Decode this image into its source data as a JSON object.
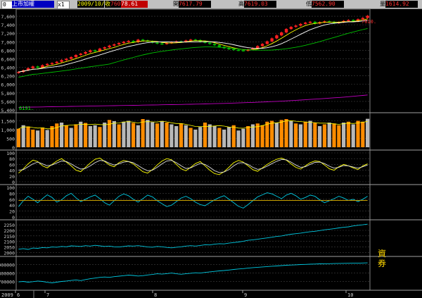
{
  "toolbar": {
    "symbol_code": "0",
    "symbol_name": "上市加權",
    "period": "x1",
    "date": "2009/10/07",
    "close_label": "收",
    "close": "7608.66",
    "open_label": "開",
    "open": "7617.79",
    "high_label": "高",
    "high": "7619.03",
    "low_label": "低",
    "low": "7562.90",
    "volume_label": "量",
    "volume": "1614.92",
    "change": "78.61"
  },
  "annotations": {
    "last_price": "7610.",
    "price_low_marker": "6191.",
    "side_label": "資券"
  },
  "colors": {
    "up": "#ff2020",
    "down": "#00c000",
    "vol_orange": "#ff8c00",
    "vol_gray": "#b8b8b8",
    "ma5": "#ffff00",
    "ma10": "#ffffff",
    "ma20": "#00c000",
    "ma60": "#c000c0",
    "cyan": "#00c8e0",
    "grid": "#404040"
  },
  "chart_data": [
    {
      "type": "candlestick",
      "name": "price",
      "y_ticks": [
        "7,600",
        "7,400",
        "7,200",
        "7,000",
        "6,800",
        "6,600",
        "6,400",
        "6,200",
        "6,000",
        "5,800",
        "5,600",
        "5,400"
      ],
      "ylim": [
        5400,
        7700
      ],
      "close": [
        6290,
        6330,
        6380,
        6420,
        6390,
        6450,
        6480,
        6500,
        6530,
        6570,
        6600,
        6640,
        6690,
        6720,
        6760,
        6800,
        6780,
        6840,
        6870,
        6910,
        6940,
        6970,
        7000,
        7020,
        6990,
        7050,
        7030,
        7010,
        6980,
        6960,
        6950,
        6970,
        6990,
        7010,
        7000,
        7030,
        7050,
        7040,
        7000,
        6980,
        6950,
        6920,
        6880,
        6850,
        6830,
        6810,
        6800,
        6790,
        6820,
        6850,
        6900,
        6950,
        7010,
        7080,
        7150,
        7220,
        7300,
        7350,
        7380,
        7420,
        7450,
        7470,
        7430,
        7460,
        7480,
        7470,
        7440,
        7460,
        7490,
        7510,
        7480,
        7530,
        7560,
        7610
      ],
      "ma60": [
        5460,
        5462,
        5464,
        5466,
        5468,
        5470,
        5472,
        5474,
        5476,
        5478,
        5480,
        5482,
        5484,
        5486,
        5488,
        5490,
        5492,
        5494,
        5496,
        5498,
        5500,
        5502,
        5504,
        5506,
        5508,
        5510,
        5512,
        5514,
        5516,
        5518,
        5520,
        5522,
        5524,
        5526,
        5528,
        5530,
        5532,
        5535,
        5538,
        5541,
        5544,
        5547,
        5550,
        5553,
        5556,
        5560,
        5564,
        5568,
        5572,
        5576,
        5580,
        5585,
        5590,
        5595,
        5600,
        5606,
        5612,
        5618,
        5625,
        5632,
        5639,
        5646,
        5653,
        5660,
        5668,
        5676,
        5684,
        5692,
        5700,
        5710,
        5720,
        5730,
        5740,
        5750
      ]
    },
    {
      "type": "bar",
      "name": "volume",
      "y_ticks": [
        "1,500",
        "1,000",
        "500",
        "0"
      ],
      "ylim": [
        0,
        1800
      ],
      "values": [
        1050,
        1250,
        1180,
        1000,
        950,
        1120,
        980,
        1200,
        1350,
        1400,
        1250,
        1100,
        1300,
        1450,
        1380,
        1200,
        1250,
        1150,
        1400,
        1550,
        1480,
        1300,
        1450,
        1500,
        1380,
        1250,
        1600,
        1550,
        1420,
        1350,
        1480,
        1400,
        1300,
        1200,
        1350,
        1250,
        1100,
        1000,
        1150,
        1400,
        1300,
        1200,
        1100,
        1000,
        1150,
        1250,
        950,
        1050,
        1200,
        1300,
        1350,
        1250,
        1450,
        1500,
        1400,
        1550,
        1600,
        1480,
        1350,
        1300,
        1450,
        1500,
        1380,
        1200,
        1300,
        1400,
        1350,
        1250,
        1400,
        1450,
        1300,
        1500,
        1450,
        1614
      ],
      "up": [
        1,
        0,
        1,
        1,
        0,
        1,
        0,
        1,
        1,
        0,
        1,
        0,
        1,
        0,
        1,
        0,
        0,
        1,
        0,
        1,
        0,
        1,
        0,
        0,
        1,
        0,
        1,
        0,
        0,
        1,
        0,
        1,
        0,
        0,
        1,
        0,
        1,
        0,
        0,
        1,
        0,
        0,
        1,
        0,
        0,
        1,
        0,
        0,
        1,
        0,
        1,
        1,
        1,
        1,
        0,
        1,
        1,
        0,
        1,
        0,
        1,
        0,
        1,
        0,
        1,
        0,
        1,
        1,
        0,
        1,
        0,
        1,
        1,
        0
      ]
    },
    {
      "type": "line",
      "name": "KD",
      "y_ticks": [
        "100",
        "80",
        "60",
        "40",
        "20",
        "0"
      ],
      "ylim": [
        0,
        100
      ],
      "series": [
        {
          "color": "#ffff00",
          "values": [
            30,
            45,
            62,
            75,
            70,
            55,
            48,
            60,
            72,
            80,
            68,
            55,
            40,
            35,
            50,
            65,
            78,
            82,
            70,
            58,
            52,
            66,
            74,
            70,
            62,
            48,
            35,
            30,
            42,
            58,
            72,
            80,
            76,
            60,
            45,
            38,
            50,
            63,
            70,
            55,
            40,
            28,
            25,
            35,
            50,
            66,
            74,
            68,
            55,
            42,
            36,
            48,
            60,
            70,
            78,
            82,
            75,
            62,
            50,
            44,
            55,
            66,
            72,
            70,
            58,
            45,
            40,
            52,
            60,
            55,
            48,
            42,
            55,
            62
          ]
        },
        {
          "color": "#e0e0e0",
          "values": [
            40,
            42,
            52,
            62,
            68,
            62,
            55,
            58,
            65,
            72,
            70,
            62,
            52,
            44,
            46,
            55,
            66,
            74,
            72,
            64,
            58,
            62,
            68,
            70,
            66,
            56,
            46,
            38,
            40,
            50,
            62,
            72,
            74,
            66,
            55,
            46,
            48,
            56,
            64,
            60,
            50,
            38,
            32,
            34,
            42,
            55,
            65,
            66,
            60,
            50,
            43,
            46,
            54,
            63,
            71,
            77,
            76,
            68,
            58,
            50,
            52,
            60,
            67,
            68,
            63,
            54,
            47,
            50,
            56,
            55,
            51,
            47,
            52,
            58
          ]
        }
      ]
    },
    {
      "type": "line",
      "name": "RSI",
      "y_ticks": [
        "100",
        "80",
        "60",
        "40",
        "20",
        "0"
      ],
      "ylim": [
        0,
        100
      ],
      "series": [
        {
          "color": "#00c8e0",
          "values": [
            35,
            55,
            70,
            60,
            48,
            62,
            75,
            66,
            50,
            58,
            72,
            80,
            65,
            52,
            60,
            68,
            74,
            62,
            48,
            40,
            55,
            70,
            78,
            72,
            60,
            50,
            62,
            74,
            68,
            55,
            45,
            35,
            40,
            52,
            64,
            70,
            62,
            50,
            42,
            38,
            48,
            58,
            66,
            72,
            60,
            48,
            36,
            30,
            42,
            55,
            68,
            75,
            82,
            78,
            70,
            62,
            74,
            80,
            72,
            60,
            66,
            74,
            70,
            58,
            48,
            55,
            62,
            70,
            64,
            56,
            60,
            52,
            60,
            70
          ]
        },
        {
          "color": "#c8a000",
          "values": [
            56,
            56,
            56,
            56,
            56,
            56,
            56,
            56,
            56,
            56,
            56,
            56,
            56,
            56,
            56,
            56,
            56,
            56,
            56,
            56,
            56,
            56,
            56,
            56,
            56,
            56,
            56,
            56,
            56,
            56,
            56,
            56,
            56,
            56,
            56,
            56,
            56,
            56,
            56,
            56,
            56,
            56,
            56,
            56,
            56,
            56,
            56,
            56,
            56,
            56,
            56,
            56,
            56,
            56,
            56,
            56,
            56,
            56,
            56,
            56,
            56,
            56,
            56,
            56,
            56,
            56,
            56,
            56,
            56,
            56,
            56,
            56,
            56,
            56
          ]
        }
      ]
    },
    {
      "type": "line",
      "name": "index2",
      "y_ticks": [
        "2250",
        "2200",
        "2150",
        "2100",
        "2050",
        "2000"
      ],
      "ylim": [
        1990,
        2270
      ],
      "series": [
        {
          "color": "#00c8e0",
          "values": [
            2030,
            2035,
            2028,
            2040,
            2038,
            2045,
            2042,
            2050,
            2048,
            2055,
            2052,
            2060,
            2058,
            2055,
            2062,
            2058,
            2065,
            2060,
            2055,
            2058,
            2052,
            2050,
            2055,
            2060,
            2058,
            2062,
            2056,
            2050,
            2048,
            2055,
            2052,
            2046,
            2042,
            2048,
            2052,
            2058,
            2062,
            2058,
            2064,
            2070,
            2068,
            2075,
            2080,
            2078,
            2085,
            2090,
            2095,
            2102,
            2110,
            2115,
            2120,
            2126,
            2132,
            2138,
            2145,
            2150,
            2158,
            2165,
            2170,
            2175,
            2182,
            2188,
            2192,
            2198,
            2205,
            2210,
            2215,
            2222,
            2228,
            2232,
            2240,
            2246,
            2250,
            2256
          ]
        }
      ]
    },
    {
      "type": "line",
      "name": "margin",
      "y_ticks": [
        "900000",
        "800000",
        "700000"
      ],
      "ylim": [
        630000,
        960000
      ],
      "series": [
        {
          "color": "#00c8e0",
          "values": [
            695000,
            700000,
            692000,
            698000,
            705000,
            700000,
            690000,
            684000,
            692000,
            700000,
            705000,
            712000,
            718000,
            710000,
            722000,
            732000,
            740000,
            748000,
            752000,
            748000,
            756000,
            762000,
            768000,
            774000,
            770000,
            764000,
            768000,
            776000,
            782000,
            790000,
            786000,
            792000,
            798000,
            790000,
            784000,
            790000,
            796000,
            802000,
            798000,
            806000,
            812000,
            818000,
            824000,
            828000,
            834000,
            840000,
            846000,
            850000,
            856000,
            862000,
            866000,
            870000,
            874000,
            878000,
            882000,
            886000,
            890000,
            892000,
            895000,
            898000,
            900000,
            902000,
            904000,
            906000,
            907000,
            908000,
            910000,
            911000,
            912000,
            913000,
            914000,
            914000,
            916000,
            918000
          ]
        }
      ]
    }
  ],
  "x_axis": {
    "labels": [
      "2009",
      "6",
      "7",
      "8",
      "9",
      "10"
    ]
  }
}
